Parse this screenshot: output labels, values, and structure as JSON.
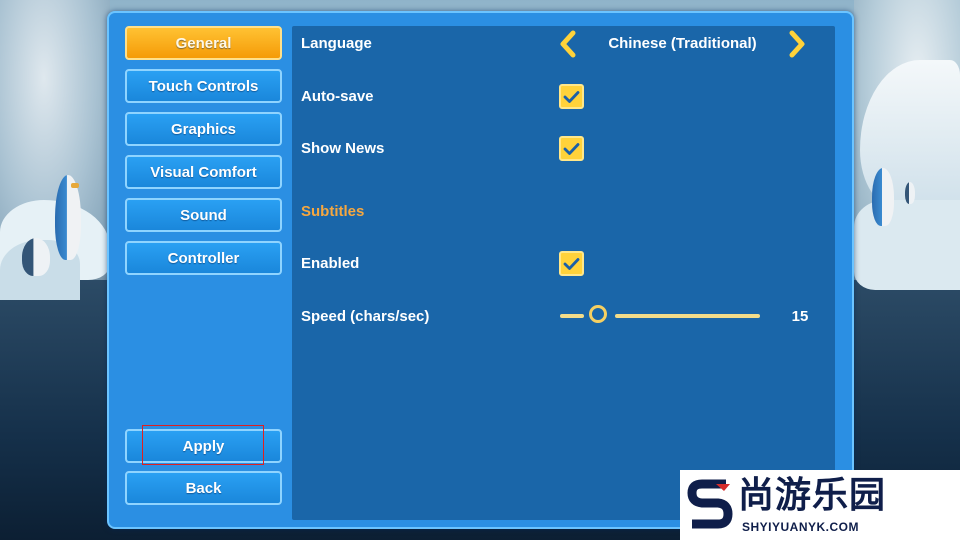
{
  "nav": {
    "items": [
      {
        "label": "General",
        "active": true
      },
      {
        "label": "Touch Controls",
        "active": false
      },
      {
        "label": "Graphics",
        "active": false
      },
      {
        "label": "Visual Comfort",
        "active": false
      },
      {
        "label": "Sound",
        "active": false
      },
      {
        "label": "Controller",
        "active": false
      }
    ],
    "apply_label": "Apply",
    "back_label": "Back"
  },
  "settings": {
    "language": {
      "label": "Language",
      "value": "Chinese (Traditional)"
    },
    "autosave": {
      "label": "Auto-save",
      "checked": true
    },
    "show_news": {
      "label": "Show News",
      "checked": true
    },
    "subtitles_header": "Subtitles",
    "subtitles_enabled": {
      "label": "Enabled",
      "checked": true
    },
    "speed": {
      "label": "Speed (chars/sec)",
      "value": "15",
      "fill_fraction": 0.2
    }
  },
  "watermark": {
    "title": "尚游乐园",
    "url": "SHYIYUANYK.COM"
  },
  "colors": {
    "accent_active": "#f59b07",
    "panel": "#1a66a9",
    "frame": "#2b8fe3",
    "checkbox": "#ffd23a",
    "section_header": "#f5a740"
  }
}
